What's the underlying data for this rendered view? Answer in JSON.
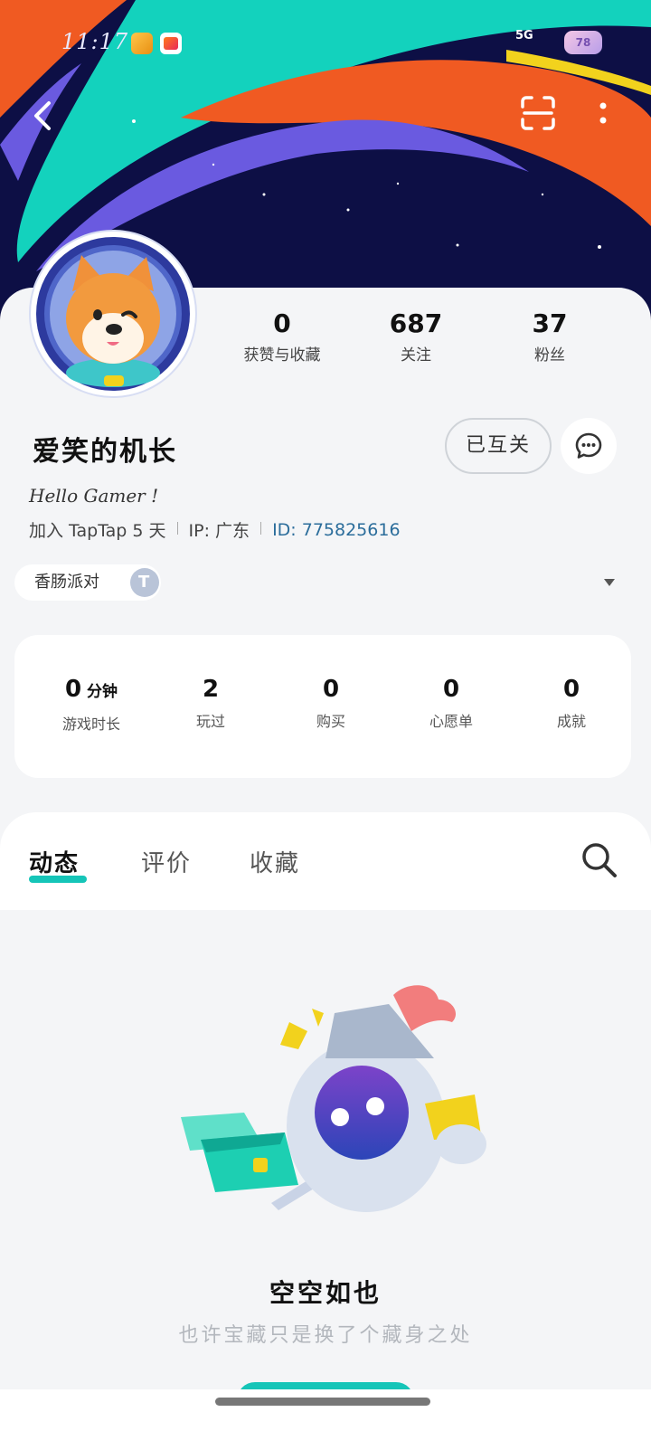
{
  "status_bar": {
    "time": "11:17",
    "network": "5G",
    "battery_level": "78"
  },
  "profile": {
    "username": "爱笑的机长",
    "bio": "Hello Gamer !",
    "joined": "加入 TapTap 5 天",
    "ip": "IP: 广东",
    "id": "ID: 775825616",
    "follow_state": "已互关",
    "badge": "香肠派对",
    "stats": [
      {
        "value": "0",
        "label": "获赞与收藏"
      },
      {
        "value": "687",
        "label": "关注"
      },
      {
        "value": "37",
        "label": "粉丝"
      }
    ]
  },
  "game_stats": [
    {
      "value": "0",
      "unit": "分钟",
      "label": "游戏时长"
    },
    {
      "value": "2",
      "unit": "",
      "label": "玩过"
    },
    {
      "value": "0",
      "unit": "",
      "label": "购买"
    },
    {
      "value": "0",
      "unit": "",
      "label": "心愿单"
    },
    {
      "value": "0",
      "unit": "",
      "label": "成就"
    }
  ],
  "tabs": [
    {
      "label": "动态",
      "active": true
    },
    {
      "label": "评价",
      "active": false
    },
    {
      "label": "收藏",
      "active": false
    }
  ],
  "empty_state": {
    "title": "空空如也",
    "subtitle": "也许宝藏只是换了个藏身之处"
  },
  "colors": {
    "accent": "#15c5b8",
    "id_text": "#2b6d9b",
    "header_bg": "#0d0f45"
  },
  "icons": [
    "back-arrow-icon",
    "scan-icon",
    "more-icon",
    "chat-icon",
    "search-icon",
    "dropdown-caret-icon",
    "badge-icon"
  ]
}
